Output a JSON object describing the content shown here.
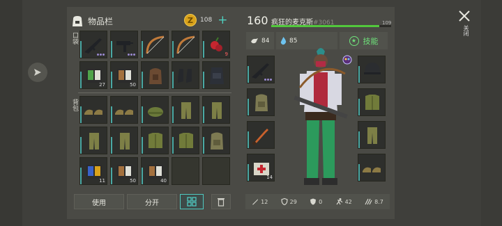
{
  "inventory": {
    "title": "物品栏",
    "coins": "108",
    "add_symbol": "+",
    "pocket_label": "口袋",
    "backpack_label": "背包"
  },
  "pocket_slots": [
    {
      "item": "rifle-icon",
      "dots": true
    },
    {
      "item": "smg-icon",
      "dots": true
    },
    {
      "item": "bow-icon",
      "dots": false
    },
    {
      "item": "bow-icon",
      "dots": false
    },
    {
      "item": "berries-icon",
      "qty": "9",
      "qty_red": true
    },
    {
      "item": "book-green-icon",
      "qty": "27"
    },
    {
      "item": "book-brown-icon",
      "qty": "50"
    },
    {
      "item": "backpack-tactical-icon"
    },
    {
      "item": "boots-icon"
    },
    {
      "item": "vest-icon"
    }
  ],
  "backpack_slots": [
    {
      "item": "shoes-icon"
    },
    {
      "item": "shoes-icon"
    },
    {
      "item": "cap-icon"
    },
    {
      "item": "pants-icon"
    },
    {
      "item": "pants-icon"
    },
    {
      "item": "pants-icon"
    },
    {
      "item": "pants-icon"
    },
    {
      "item": "jacket-icon"
    },
    {
      "item": "jacket-icon"
    },
    {
      "item": "backpack-icon"
    },
    {
      "item": "book-blue-icon",
      "qty": "11"
    },
    {
      "item": "book-brown-icon",
      "qty": "50"
    },
    {
      "item": "book-brown-icon",
      "qty": "40"
    },
    {
      "item": ""
    },
    {
      "item": ""
    }
  ],
  "actions": {
    "use": "使用",
    "split": "分开",
    "grid_icon": "grid-icon",
    "trash_icon": "trash-icon"
  },
  "character": {
    "level": "160",
    "name": "疯狂的麦克斯",
    "id": "#3061",
    "hp": "109",
    "hp_fraction": 0.9,
    "food": "84",
    "water": "85",
    "skill_label": "技能"
  },
  "equipment_left": [
    {
      "item": "rifle-icon",
      "dots": true
    },
    {
      "item": "backpack-icon"
    },
    {
      "item": "knife-icon"
    },
    {
      "item": "medkit-icon",
      "qty": "14"
    }
  ],
  "equipment_right": [
    {
      "item": "helmet-icon"
    },
    {
      "item": "jacket-icon"
    },
    {
      "item": "pants-icon"
    },
    {
      "item": "shoes-icon"
    }
  ],
  "bottom_stats": {
    "attack": "12",
    "defense": "29",
    "armor": "0",
    "speed": "42",
    "stealth": "8.7"
  },
  "close_label": "关闭",
  "colors": {
    "accent": "#4fc9c0",
    "hp": "#52c83c",
    "skill": "#6fe27b",
    "coin": "#d9a21b"
  }
}
